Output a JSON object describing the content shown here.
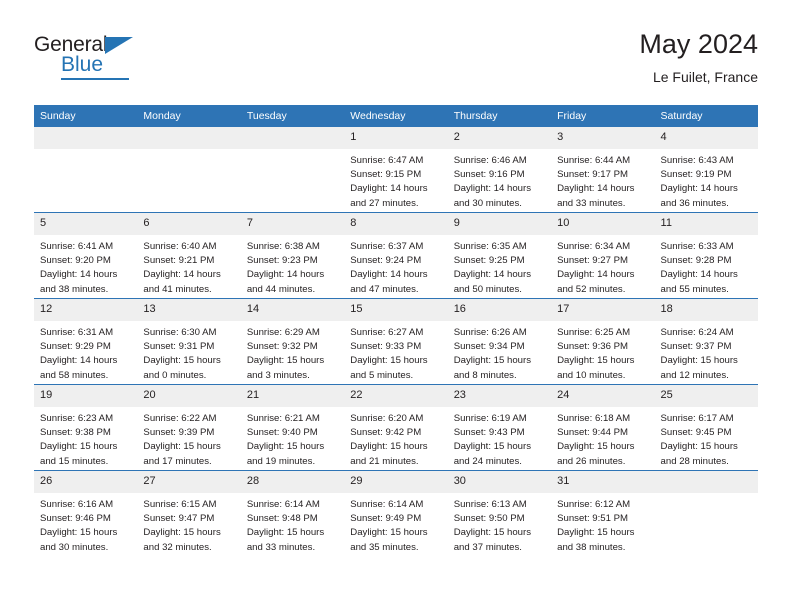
{
  "brand": {
    "name_part1": "General",
    "name_part2": "Blue",
    "colors": {
      "blue": "#2574b4",
      "dark": "#231f20"
    }
  },
  "header": {
    "title": "May 2024",
    "location": "Le Fuilet, France"
  },
  "theme": {
    "header_blue": "#2e74b5",
    "daynum_band": "#efefef",
    "text": "#231f20"
  },
  "calendar": {
    "weekday_headers": [
      "Sunday",
      "Monday",
      "Tuesday",
      "Wednesday",
      "Thursday",
      "Friday",
      "Saturday"
    ],
    "labels": {
      "sunrise_prefix": "Sunrise:",
      "sunset_prefix": "Sunset:",
      "daylight_prefix": "Daylight:"
    },
    "weeks": [
      [
        {
          "day": "",
          "empty": true
        },
        {
          "day": "",
          "empty": true
        },
        {
          "day": "",
          "empty": true
        },
        {
          "day": "1",
          "sunrise": "Sunrise: 6:47 AM",
          "sunset": "Sunset: 9:15 PM",
          "daylight_l1": "Daylight: 14 hours",
          "daylight_l2": "and 27 minutes."
        },
        {
          "day": "2",
          "sunrise": "Sunrise: 6:46 AM",
          "sunset": "Sunset: 9:16 PM",
          "daylight_l1": "Daylight: 14 hours",
          "daylight_l2": "and 30 minutes."
        },
        {
          "day": "3",
          "sunrise": "Sunrise: 6:44 AM",
          "sunset": "Sunset: 9:17 PM",
          "daylight_l1": "Daylight: 14 hours",
          "daylight_l2": "and 33 minutes."
        },
        {
          "day": "4",
          "sunrise": "Sunrise: 6:43 AM",
          "sunset": "Sunset: 9:19 PM",
          "daylight_l1": "Daylight: 14 hours",
          "daylight_l2": "and 36 minutes."
        }
      ],
      [
        {
          "day": "5",
          "sunrise": "Sunrise: 6:41 AM",
          "sunset": "Sunset: 9:20 PM",
          "daylight_l1": "Daylight: 14 hours",
          "daylight_l2": "and 38 minutes."
        },
        {
          "day": "6",
          "sunrise": "Sunrise: 6:40 AM",
          "sunset": "Sunset: 9:21 PM",
          "daylight_l1": "Daylight: 14 hours",
          "daylight_l2": "and 41 minutes."
        },
        {
          "day": "7",
          "sunrise": "Sunrise: 6:38 AM",
          "sunset": "Sunset: 9:23 PM",
          "daylight_l1": "Daylight: 14 hours",
          "daylight_l2": "and 44 minutes."
        },
        {
          "day": "8",
          "sunrise": "Sunrise: 6:37 AM",
          "sunset": "Sunset: 9:24 PM",
          "daylight_l1": "Daylight: 14 hours",
          "daylight_l2": "and 47 minutes."
        },
        {
          "day": "9",
          "sunrise": "Sunrise: 6:35 AM",
          "sunset": "Sunset: 9:25 PM",
          "daylight_l1": "Daylight: 14 hours",
          "daylight_l2": "and 50 minutes."
        },
        {
          "day": "10",
          "sunrise": "Sunrise: 6:34 AM",
          "sunset": "Sunset: 9:27 PM",
          "daylight_l1": "Daylight: 14 hours",
          "daylight_l2": "and 52 minutes."
        },
        {
          "day": "11",
          "sunrise": "Sunrise: 6:33 AM",
          "sunset": "Sunset: 9:28 PM",
          "daylight_l1": "Daylight: 14 hours",
          "daylight_l2": "and 55 minutes."
        }
      ],
      [
        {
          "day": "12",
          "sunrise": "Sunrise: 6:31 AM",
          "sunset": "Sunset: 9:29 PM",
          "daylight_l1": "Daylight: 14 hours",
          "daylight_l2": "and 58 minutes."
        },
        {
          "day": "13",
          "sunrise": "Sunrise: 6:30 AM",
          "sunset": "Sunset: 9:31 PM",
          "daylight_l1": "Daylight: 15 hours",
          "daylight_l2": "and 0 minutes."
        },
        {
          "day": "14",
          "sunrise": "Sunrise: 6:29 AM",
          "sunset": "Sunset: 9:32 PM",
          "daylight_l1": "Daylight: 15 hours",
          "daylight_l2": "and 3 minutes."
        },
        {
          "day": "15",
          "sunrise": "Sunrise: 6:27 AM",
          "sunset": "Sunset: 9:33 PM",
          "daylight_l1": "Daylight: 15 hours",
          "daylight_l2": "and 5 minutes."
        },
        {
          "day": "16",
          "sunrise": "Sunrise: 6:26 AM",
          "sunset": "Sunset: 9:34 PM",
          "daylight_l1": "Daylight: 15 hours",
          "daylight_l2": "and 8 minutes."
        },
        {
          "day": "17",
          "sunrise": "Sunrise: 6:25 AM",
          "sunset": "Sunset: 9:36 PM",
          "daylight_l1": "Daylight: 15 hours",
          "daylight_l2": "and 10 minutes."
        },
        {
          "day": "18",
          "sunrise": "Sunrise: 6:24 AM",
          "sunset": "Sunset: 9:37 PM",
          "daylight_l1": "Daylight: 15 hours",
          "daylight_l2": "and 12 minutes."
        }
      ],
      [
        {
          "day": "19",
          "sunrise": "Sunrise: 6:23 AM",
          "sunset": "Sunset: 9:38 PM",
          "daylight_l1": "Daylight: 15 hours",
          "daylight_l2": "and 15 minutes."
        },
        {
          "day": "20",
          "sunrise": "Sunrise: 6:22 AM",
          "sunset": "Sunset: 9:39 PM",
          "daylight_l1": "Daylight: 15 hours",
          "daylight_l2": "and 17 minutes."
        },
        {
          "day": "21",
          "sunrise": "Sunrise: 6:21 AM",
          "sunset": "Sunset: 9:40 PM",
          "daylight_l1": "Daylight: 15 hours",
          "daylight_l2": "and 19 minutes."
        },
        {
          "day": "22",
          "sunrise": "Sunrise: 6:20 AM",
          "sunset": "Sunset: 9:42 PM",
          "daylight_l1": "Daylight: 15 hours",
          "daylight_l2": "and 21 minutes."
        },
        {
          "day": "23",
          "sunrise": "Sunrise: 6:19 AM",
          "sunset": "Sunset: 9:43 PM",
          "daylight_l1": "Daylight: 15 hours",
          "daylight_l2": "and 24 minutes."
        },
        {
          "day": "24",
          "sunrise": "Sunrise: 6:18 AM",
          "sunset": "Sunset: 9:44 PM",
          "daylight_l1": "Daylight: 15 hours",
          "daylight_l2": "and 26 minutes."
        },
        {
          "day": "25",
          "sunrise": "Sunrise: 6:17 AM",
          "sunset": "Sunset: 9:45 PM",
          "daylight_l1": "Daylight: 15 hours",
          "daylight_l2": "and 28 minutes."
        }
      ],
      [
        {
          "day": "26",
          "sunrise": "Sunrise: 6:16 AM",
          "sunset": "Sunset: 9:46 PM",
          "daylight_l1": "Daylight: 15 hours",
          "daylight_l2": "and 30 minutes."
        },
        {
          "day": "27",
          "sunrise": "Sunrise: 6:15 AM",
          "sunset": "Sunset: 9:47 PM",
          "daylight_l1": "Daylight: 15 hours",
          "daylight_l2": "and 32 minutes."
        },
        {
          "day": "28",
          "sunrise": "Sunrise: 6:14 AM",
          "sunset": "Sunset: 9:48 PM",
          "daylight_l1": "Daylight: 15 hours",
          "daylight_l2": "and 33 minutes."
        },
        {
          "day": "29",
          "sunrise": "Sunrise: 6:14 AM",
          "sunset": "Sunset: 9:49 PM",
          "daylight_l1": "Daylight: 15 hours",
          "daylight_l2": "and 35 minutes."
        },
        {
          "day": "30",
          "sunrise": "Sunrise: 6:13 AM",
          "sunset": "Sunset: 9:50 PM",
          "daylight_l1": "Daylight: 15 hours",
          "daylight_l2": "and 37 minutes."
        },
        {
          "day": "31",
          "sunrise": "Sunrise: 6:12 AM",
          "sunset": "Sunset: 9:51 PM",
          "daylight_l1": "Daylight: 15 hours",
          "daylight_l2": "and 38 minutes."
        },
        {
          "day": "",
          "empty": true
        }
      ]
    ]
  }
}
